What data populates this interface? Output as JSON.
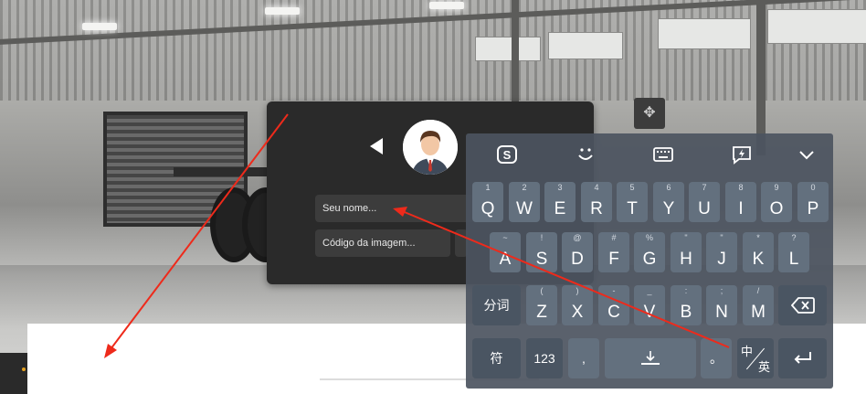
{
  "login": {
    "name_placeholder": "Seu nome...",
    "captcha_placeholder": "Código da imagem..."
  },
  "keyboard": {
    "toolbar": [
      "sogou-logo-icon",
      "emoji-icon",
      "keyboard-layout-icon",
      "quick-phrase-icon",
      "collapse-chevron-icon"
    ],
    "row1": [
      {
        "main": "Q",
        "sup": "1"
      },
      {
        "main": "W",
        "sup": "2"
      },
      {
        "main": "E",
        "sup": "3"
      },
      {
        "main": "R",
        "sup": "4"
      },
      {
        "main": "T",
        "sup": "5"
      },
      {
        "main": "Y",
        "sup": "6"
      },
      {
        "main": "U",
        "sup": "7"
      },
      {
        "main": "I",
        "sup": "8"
      },
      {
        "main": "O",
        "sup": "9"
      },
      {
        "main": "P",
        "sup": "0"
      }
    ],
    "row2": [
      {
        "main": "A",
        "sup": "~"
      },
      {
        "main": "S",
        "sup": "!"
      },
      {
        "main": "D",
        "sup": "@"
      },
      {
        "main": "F",
        "sup": "#"
      },
      {
        "main": "G",
        "sup": "%"
      },
      {
        "main": "H",
        "sup": "\""
      },
      {
        "main": "J",
        "sup": "\""
      },
      {
        "main": "K",
        "sup": "*"
      },
      {
        "main": "L",
        "sup": "?"
      }
    ],
    "row3": [
      {
        "main": "Z",
        "sup": "("
      },
      {
        "main": "X",
        "sup": ")"
      },
      {
        "main": "C",
        "sup": "-"
      },
      {
        "main": "V",
        "sup": "_"
      },
      {
        "main": "B",
        "sup": ":"
      },
      {
        "main": "N",
        "sup": ";"
      },
      {
        "main": "M",
        "sup": "/"
      }
    ],
    "fenci": "分词",
    "fu": "符",
    "num": "123",
    "comma": ",",
    "period": "。",
    "lang_top": "中",
    "lang_bottom": "英"
  }
}
